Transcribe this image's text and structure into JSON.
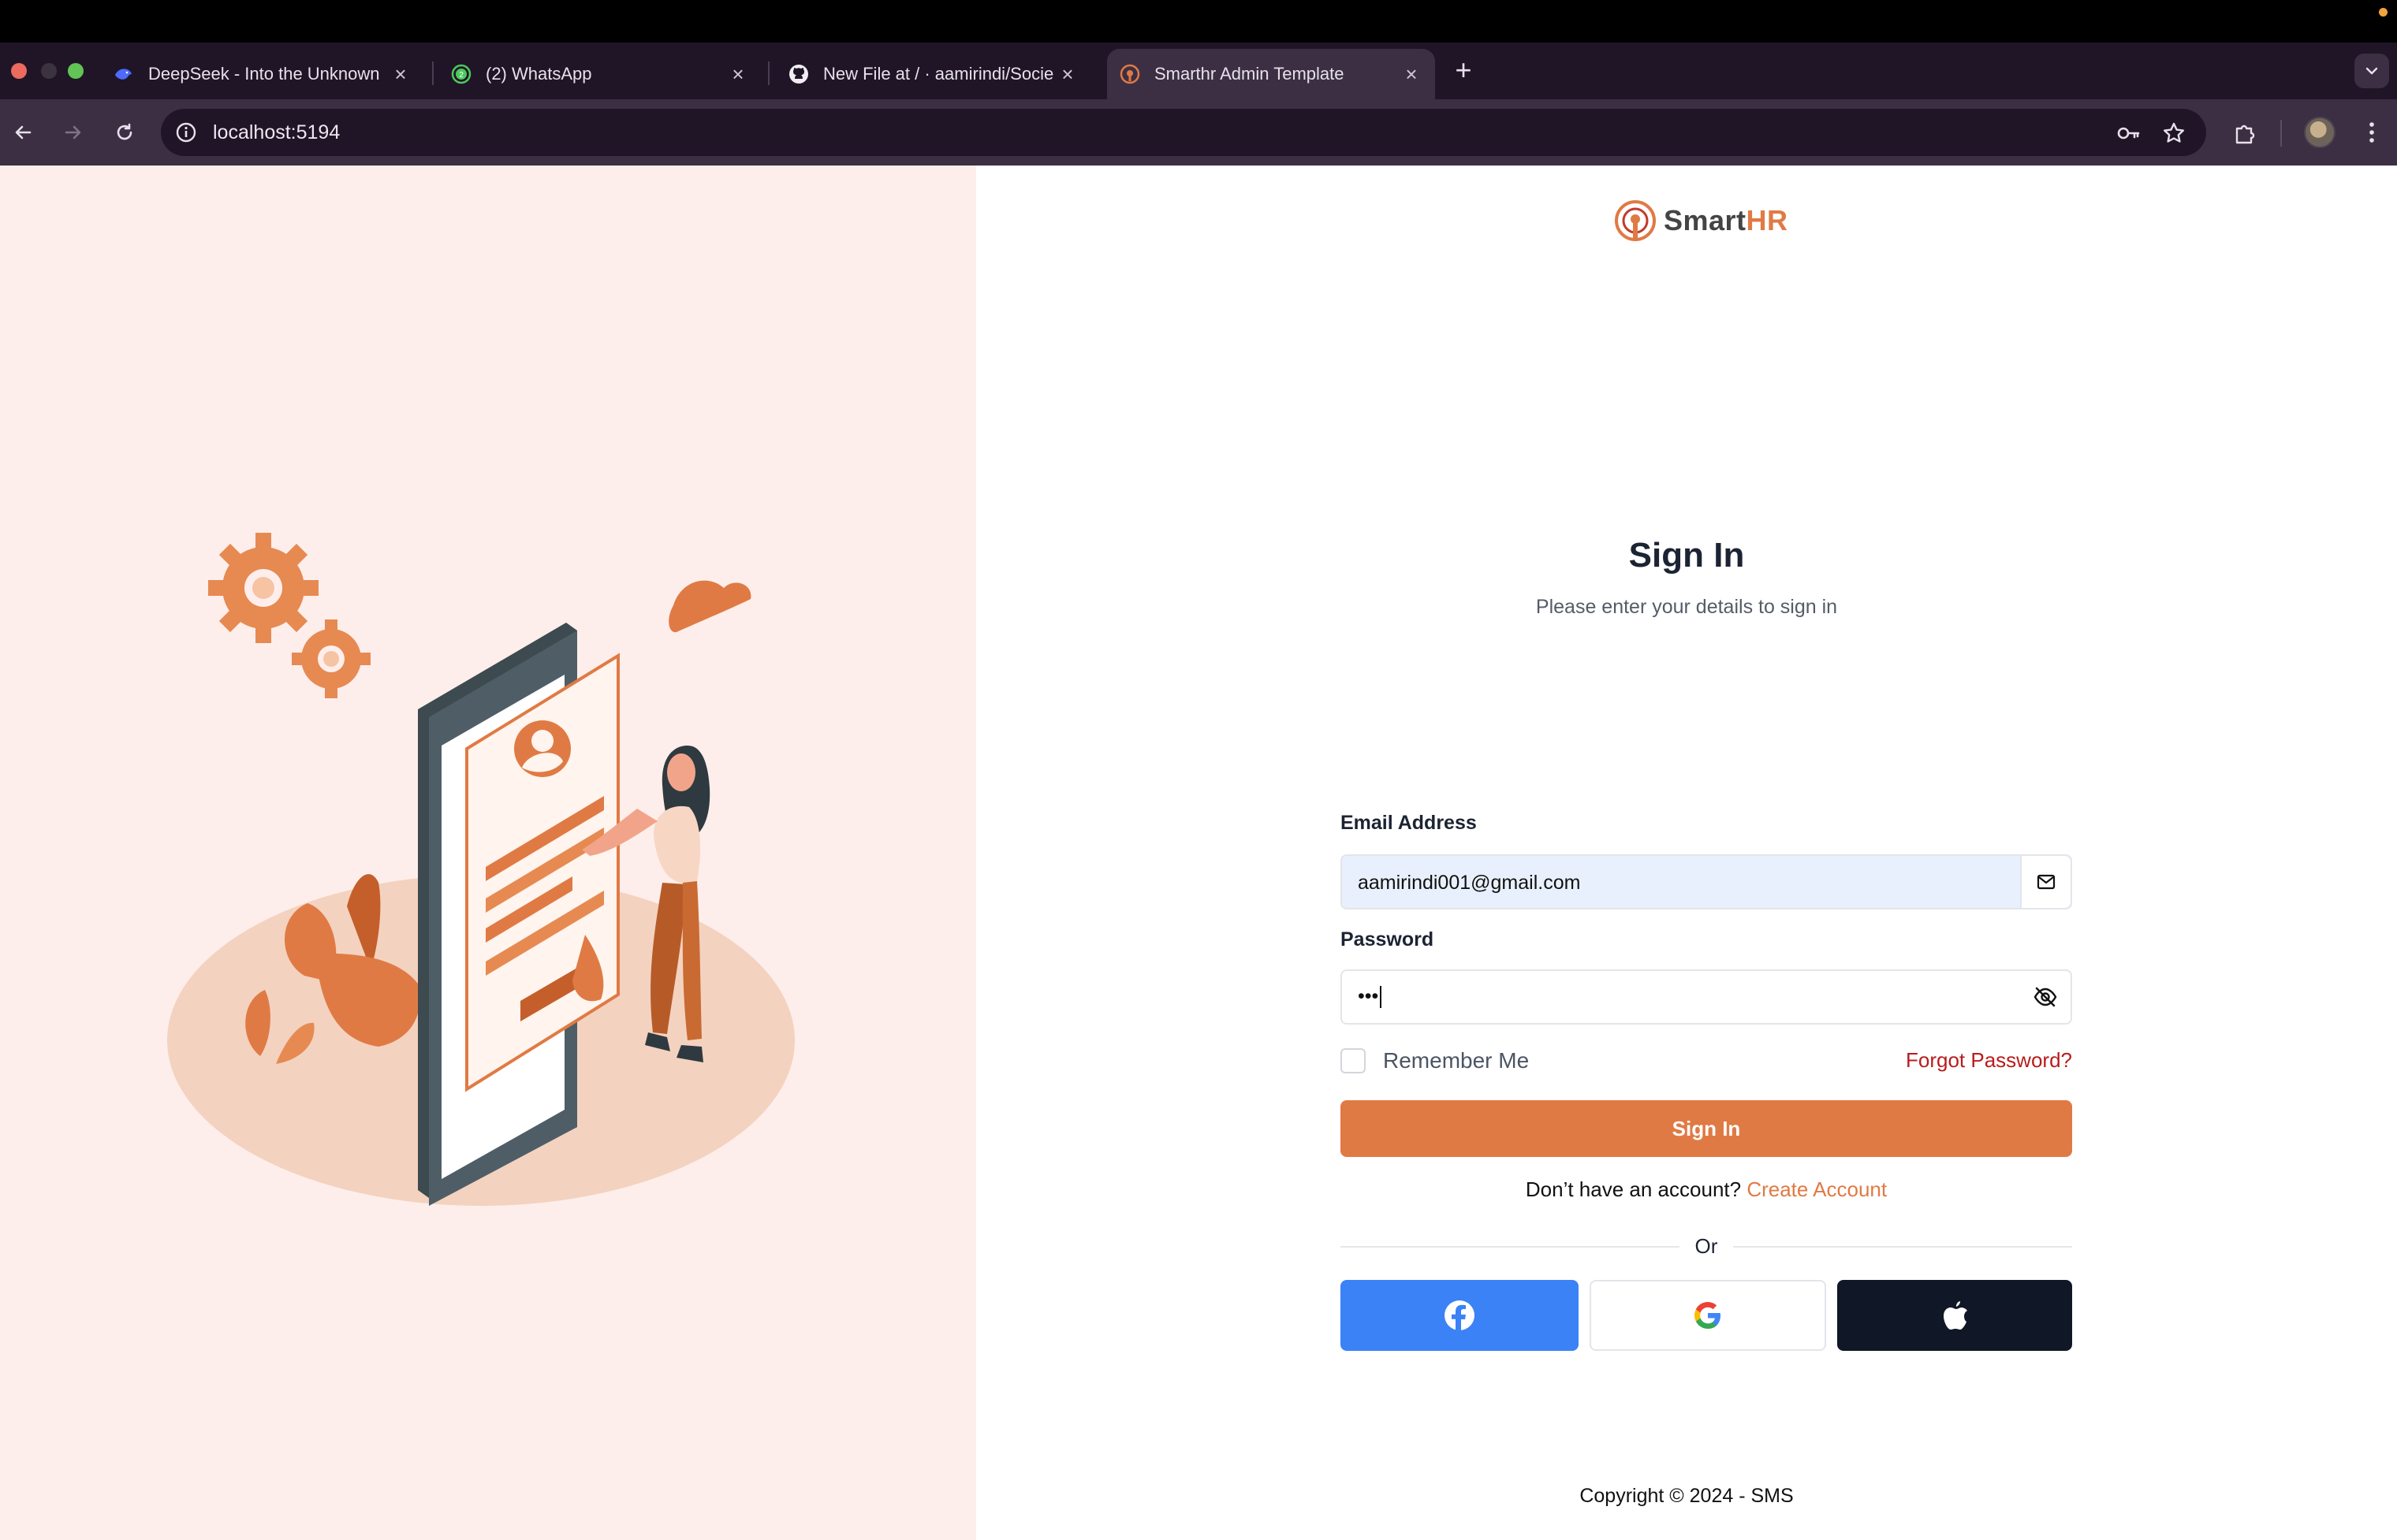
{
  "browser": {
    "tabs": [
      {
        "title": "DeepSeek - Into the Unknown",
        "icon": "deepseek-whale-icon"
      },
      {
        "title": "(2) WhatsApp",
        "icon": "whatsapp-icon",
        "badge": "2"
      },
      {
        "title": "New File at / · aamirindi/Socie",
        "icon": "github-icon"
      },
      {
        "title": "Smarthr Admin Template",
        "icon": "smarthr-logo-icon",
        "active": true
      }
    ],
    "url": "localhost:5194"
  },
  "app": {
    "brand_prefix": "Smart",
    "brand_suffix": "HR",
    "accent_color": "#e07a44"
  },
  "signin": {
    "heading": "Sign In",
    "subheading": "Please enter your details to sign in",
    "email_label": "Email Address",
    "email_value": "aamirindi001@gmail.com",
    "password_label": "Password",
    "password_value": "•••",
    "remember_label": "Remember Me",
    "forgot_label": "Forgot Password?",
    "submit_label": "Sign In",
    "no_account_text": "Don’t have an account?",
    "create_account_label": "Create Account",
    "or_label": "Or",
    "social": [
      "facebook",
      "google",
      "apple"
    ]
  },
  "footer": {
    "copyright": "Copyright © 2024 - SMS"
  }
}
